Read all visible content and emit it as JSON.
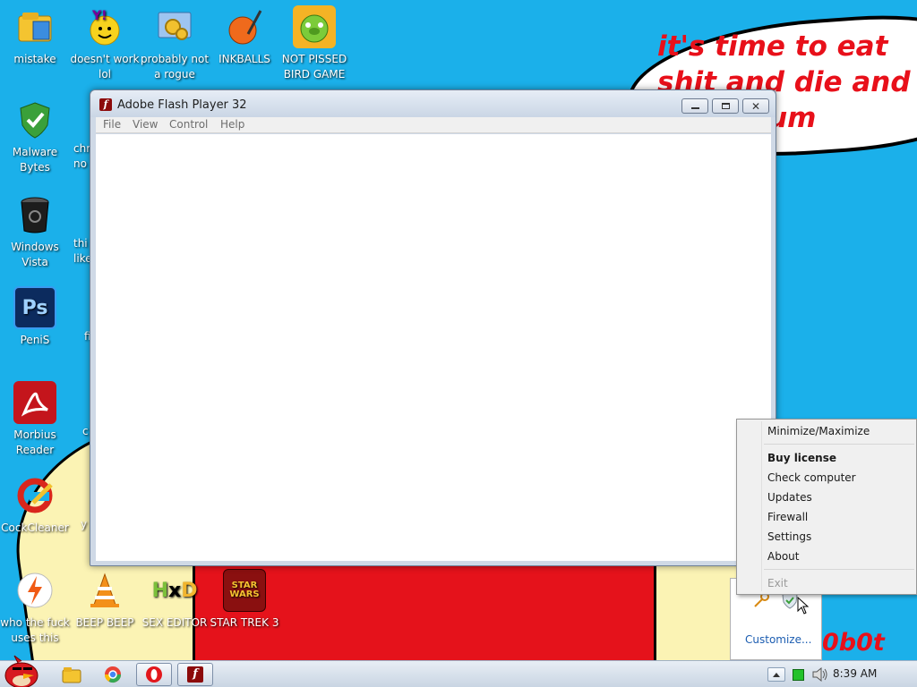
{
  "wallpaper": {
    "speech_text": "it's time to eat shit and die and chew gum",
    "corner_text": "0b0t"
  },
  "desktop_icons": [
    {
      "label": "mistake",
      "icon": "folder-app-icon"
    },
    {
      "label": "doesn't work lol",
      "icon": "yahoo-messenger-icon"
    },
    {
      "label": "probably not a rogue",
      "icon": "settings-gears-icon"
    },
    {
      "label": "INKBALLS",
      "icon": "inkball-icon"
    },
    {
      "label": "NOT PISSED BIRD GAME",
      "icon": "bad-piggies-icon"
    },
    {
      "label": "Malware Bytes",
      "icon": "shield-check-icon"
    },
    {
      "label": "chr no",
      "icon": "chrome-icon"
    },
    {
      "label": "Windows Vista",
      "icon": "trash-can-icon"
    },
    {
      "label": "thi like",
      "icon": "chrome-icon"
    },
    {
      "label": "PeniS",
      "icon": "photoshop-icon"
    },
    {
      "label": "fi",
      "icon": "firefox-icon"
    },
    {
      "label": "Morbius Reader",
      "icon": "pdf-reader-icon"
    },
    {
      "label": "c",
      "icon": "app-icon"
    },
    {
      "label": "CockCleaner",
      "icon": "ccleaner-icon"
    },
    {
      "label": "y",
      "icon": "app-icon"
    },
    {
      "label": "who the fuck uses this",
      "icon": "lightning-icon"
    },
    {
      "label": "BEEP BEEP",
      "icon": "vlc-cone-icon"
    },
    {
      "label": "SEX EDITOR",
      "icon": "hxd-icon"
    },
    {
      "label": "STAR TREK 3",
      "icon": "star-wars-icon"
    }
  ],
  "flash_window": {
    "title": "Adobe Flash Player 32",
    "menu": [
      "File",
      "View",
      "Control",
      "Help"
    ]
  },
  "context_menu": {
    "items": [
      "Minimize/Maximize",
      "Buy license",
      "Check computer",
      "Updates",
      "Firewall",
      "Settings",
      "About",
      "Exit"
    ]
  },
  "tray_popup": {
    "customize_label": "Customize..."
  },
  "taskbar": {
    "clock": "8:39 AM"
  },
  "colors": {
    "wallpaper_blue": "#1bb0ea",
    "speech_red": "#e8101a",
    "taskbar_gradient_top": "#e8eef5"
  }
}
